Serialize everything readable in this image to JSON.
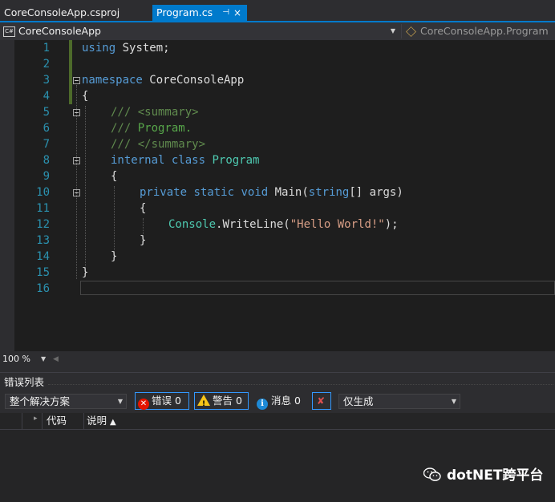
{
  "tabs": [
    {
      "label": "CoreConsoleApp.csproj",
      "active": false
    },
    {
      "label": "Program.cs",
      "active": true,
      "pin_icon": "⊣",
      "close_icon": "×"
    }
  ],
  "navbar": {
    "project": "CoreConsoleApp",
    "type": "CoreConsoleApp.Program"
  },
  "editor": {
    "line_numbers": [
      "1",
      "2",
      "3",
      "4",
      "5",
      "6",
      "7",
      "8",
      "9",
      "10",
      "11",
      "12",
      "13",
      "14",
      "15",
      "16"
    ],
    "lines": {
      "l1": {
        "kw": "using",
        "rest": " System;"
      },
      "l3": {
        "kw": "namespace",
        "rest": " CoreConsoleApp"
      },
      "l4": "{",
      "l5": {
        "xd": "/// <summary>"
      },
      "l6": {
        "xd": "/// ",
        "cm": "Program."
      },
      "l7": {
        "xd": "/// </summary>"
      },
      "l8": {
        "kw1": "internal",
        "kw2": "class",
        "type": "Program"
      },
      "l9": "{",
      "l10": {
        "kw1": "private",
        "kw2": "static",
        "kw3": "void",
        "name": "Main(",
        "kw4": "string",
        "rest": "[] args)"
      },
      "l11": "{",
      "l12": {
        "type": "Console",
        "mid": ".WriteLine(",
        "str": "\"Hello World!\"",
        "end": ");"
      },
      "l13": "}",
      "l14": "}",
      "l15": "}"
    }
  },
  "zoom": {
    "value": "100 %"
  },
  "error_list": {
    "title": "错误列表",
    "scope": "整个解决方案",
    "errors_label": "错误 0",
    "warnings_label": "警告 0",
    "messages_label": "消息 0",
    "build_filter": "仅生成",
    "columns": {
      "code": "代码",
      "description": "说明"
    }
  },
  "watermark": "dotNET跨平台",
  "colors": {
    "accent": "#007acc",
    "keyword": "#569cd6",
    "type": "#4ec9b0",
    "comment": "#57a64a",
    "string": "#d69d85"
  }
}
